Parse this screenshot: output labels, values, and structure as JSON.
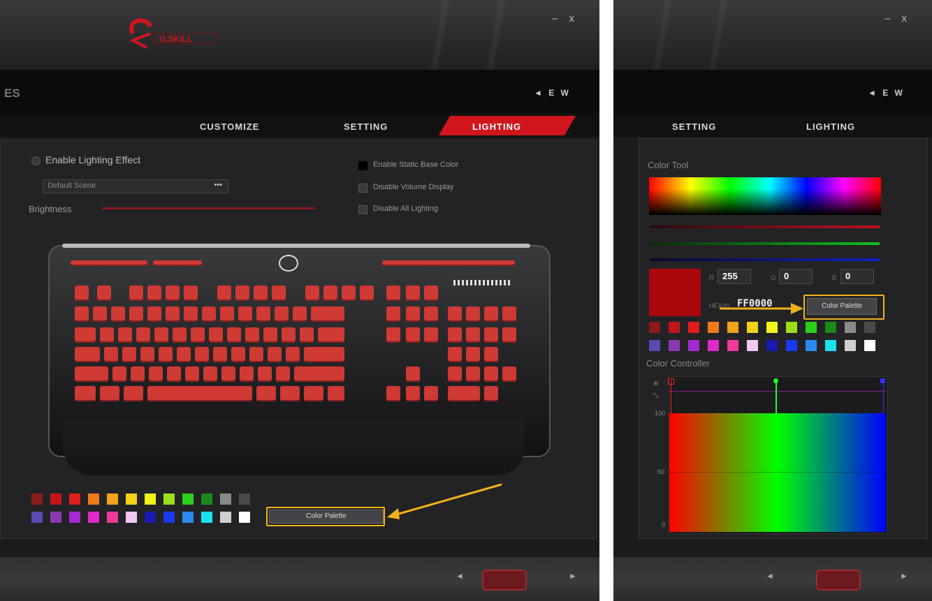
{
  "left_window": {
    "header": {
      "title": "ES",
      "window_controls": "– x",
      "lang": "◄ E W"
    },
    "tabs": [
      {
        "label": "CUSTOMIZE",
        "active": false
      },
      {
        "label": "SETTING",
        "active": false
      },
      {
        "label": "LIGHTING",
        "active": true
      }
    ],
    "lighting": {
      "enable_label": "Enable Lighting Effect",
      "scene_value": "Default Scene",
      "scene_btn": "•••",
      "brightness_label": "Brightness",
      "checks": [
        {
          "label": "Enable Static Base Color",
          "checked": true
        },
        {
          "label": "Disable Volume Display",
          "checked": false
        },
        {
          "label": "Disable All Lighting",
          "checked": false
        }
      ],
      "palette_rows": [
        [
          "#8b1a1a",
          "#c4141a",
          "#e01c1c",
          "#f07a1a",
          "#f2a51a",
          "#f2d21a",
          "#f2f21a",
          "#9ae01a",
          "#2ad01a",
          "#1a8a1a",
          "#8a8a8a",
          "#4a4a4a"
        ],
        [
          "#5a4ab0",
          "#8a3ab0",
          "#a22ad0",
          "#e02ac8",
          "#f03a9a",
          "#f0c8f0",
          "#1a1ab0",
          "#1a3af0",
          "#2a8af0",
          "#1ae0f0",
          "#d0d0d0",
          "#ffffff"
        ]
      ],
      "color_palette_btn": "Color Palette"
    }
  },
  "right_window": {
    "header": {
      "window_controls": "– x",
      "lang": "◄ E W"
    },
    "tabs": [
      {
        "label": "SETTING",
        "active": false
      },
      {
        "label": "LIGHTING",
        "active": false
      }
    ],
    "color_tool": {
      "title": "Color Tool",
      "r_label": "R",
      "r_value": "255",
      "g_label": "G",
      "g_value": "0",
      "b_label": "B",
      "b_value": "0",
      "hex_label": "HEX(#)",
      "hex_value": "FF0000",
      "color_palette_btn": "Color Palette",
      "swatch_color": "#a8070c"
    },
    "color_controller": {
      "title": "Color Controller",
      "y_ticks": [
        "100",
        "50",
        "0"
      ],
      "markers": [
        "R",
        "G",
        "B"
      ]
    }
  },
  "footer": {
    "prev": "◄",
    "next": "►",
    "apply": ""
  },
  "annotation_color": "#f2b21a"
}
